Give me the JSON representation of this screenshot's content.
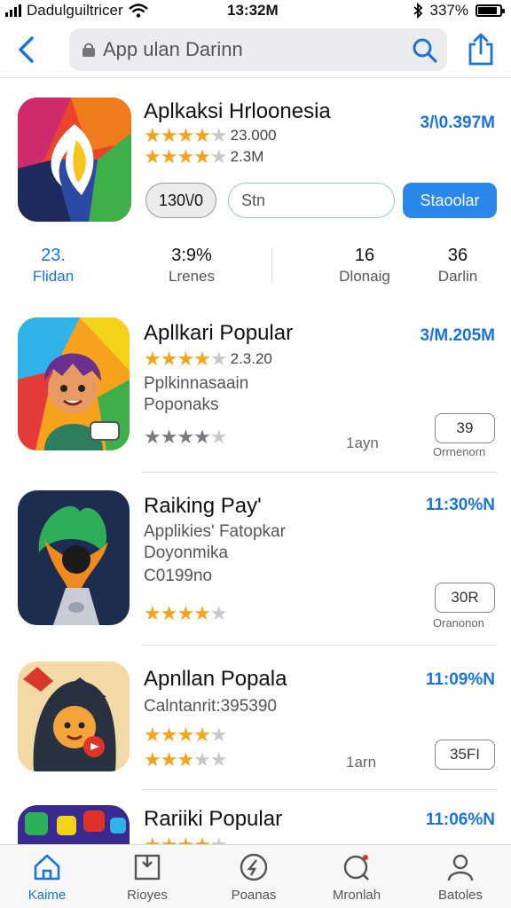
{
  "status": {
    "carrier": "Dadulguiltricer",
    "time": "13:32M",
    "battery": "337%"
  },
  "search": {
    "value": "App ulan Darinn"
  },
  "featured": {
    "title": "Aplkaksi Hrloonesia",
    "price": "3/\\0.397M",
    "rating1": "23.000",
    "rating2": "2.3M",
    "btn_left": "130\\/0",
    "btn_mid": "Stn",
    "btn_right": "Staoolar"
  },
  "stats": [
    {
      "value": "23.",
      "label": "Flidan"
    },
    {
      "value": "3:9%",
      "label": "Lrenes"
    },
    {
      "value": "16",
      "label": "Dlonaig"
    },
    {
      "value": "36",
      "label": "Darlin"
    }
  ],
  "apps": [
    {
      "title": "Apllkari Popular",
      "price": "3/M.205M",
      "rating": "2.3.20",
      "sub1": "Pplkinnasaain",
      "sub2": "Poponaks",
      "meta": "1ayn",
      "btn": "39",
      "btn_caption": "Orrnenorn"
    },
    {
      "title": "Raiking Pay'",
      "price": "11:30%N",
      "sub1": "Applikies' Fatopkar",
      "sub2": "Doyonmika",
      "sub3": "C0199no",
      "btn": "30R",
      "btn_caption": "Oranonon"
    },
    {
      "title": "Apnllan Popala",
      "price": "11:09%N",
      "sub1": "Calntanrit:395390",
      "meta": "1arn",
      "btn": "35FI"
    },
    {
      "title": "Rariiki Popular",
      "price": "11:06%N"
    }
  ],
  "tabs": [
    {
      "label": "Kaime"
    },
    {
      "label": "Rioyes"
    },
    {
      "label": "Poanas"
    },
    {
      "label": "Mronlah"
    },
    {
      "label": "Batoles"
    }
  ],
  "colors": {
    "accent": "#1a74d8",
    "star": "#f2a51a"
  }
}
